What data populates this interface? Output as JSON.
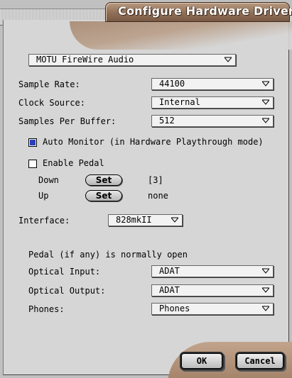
{
  "window": {
    "title": "Configure Hardware Driver"
  },
  "device_select": {
    "value": "MOTU FireWire Audio"
  },
  "sample_rate": {
    "label": "Sample Rate:",
    "value": "44100"
  },
  "clock_source": {
    "label": "Clock Source:",
    "value": "Internal"
  },
  "samples_per_buffer": {
    "label": "Samples Per Buffer:",
    "value": "512"
  },
  "auto_monitor": {
    "label": "Auto Monitor (in Hardware Playthrough mode)",
    "checked": true
  },
  "enable_pedal": {
    "label": "Enable Pedal",
    "checked": false
  },
  "pedal_down": {
    "label": "Down",
    "button": "Set",
    "value": "[3]"
  },
  "pedal_up": {
    "label": "Up",
    "button": "Set",
    "value": "none"
  },
  "interface": {
    "label": "Interface:",
    "value": "828mkII"
  },
  "pedal_note": "Pedal (if any) is normally open",
  "optical_input": {
    "label": "Optical Input:",
    "value": "ADAT"
  },
  "optical_output": {
    "label": "Optical Output:",
    "value": "ADAT"
  },
  "phones": {
    "label": "Phones:",
    "value": "Phones"
  },
  "buttons": {
    "ok": "OK",
    "cancel": "Cancel"
  },
  "colors": {
    "title_tab": "#8f6f56",
    "checkbox_fill": "#2b3fb8",
    "panel": "#d6d6d6"
  }
}
